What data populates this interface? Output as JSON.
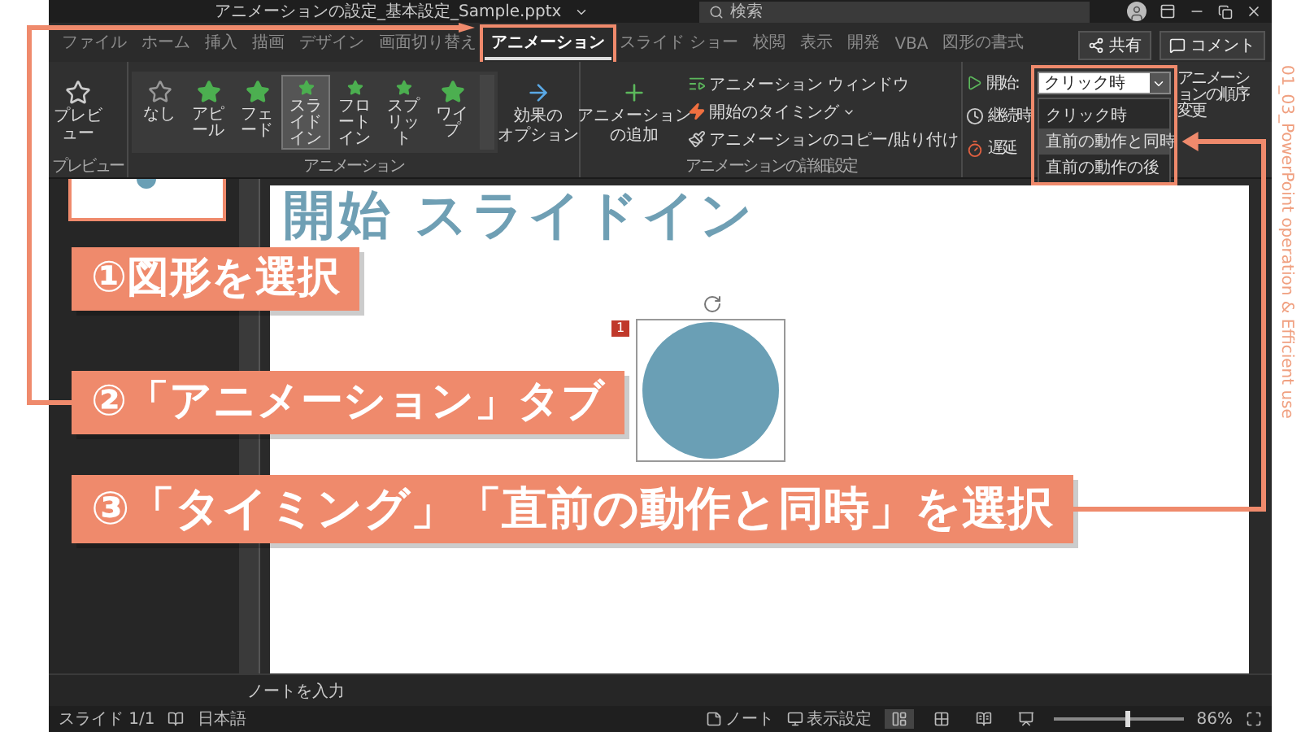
{
  "window": {
    "title": "アニメーションの設定_基本設定_Sample.pptx",
    "search": {
      "placeholder": "検索"
    }
  },
  "menu_tabs": [
    {
      "label": "ファイル",
      "selected": false
    },
    {
      "label": "ホーム",
      "selected": false
    },
    {
      "label": "挿入",
      "selected": false
    },
    {
      "label": "描画",
      "selected": false
    },
    {
      "label": "デザイン",
      "selected": false
    },
    {
      "label": "画面切り替え",
      "selected": false
    },
    {
      "label": "アニメーション",
      "selected": true
    },
    {
      "label": "スライド ショー",
      "selected": false
    },
    {
      "label": "校閲",
      "selected": false
    },
    {
      "label": "表示",
      "selected": false
    },
    {
      "label": "開発",
      "selected": false
    },
    {
      "label": "VBA",
      "selected": false
    },
    {
      "label": "図形の書式",
      "selected": false
    }
  ],
  "header_buttons": [
    {
      "label": "共有",
      "kind": "share"
    },
    {
      "label": "コメント",
      "kind": "comment"
    }
  ],
  "ribbon": {
    "preview": {
      "label": "プレビュー",
      "group": "プレビュー"
    },
    "animation": {
      "group": "アニメーション",
      "effect_options": [
        "効果の",
        "オプション"
      ],
      "gallery": [
        {
          "label": "なし",
          "kind": "none",
          "selected": false
        },
        {
          "label": "アピール",
          "kind": "entrance",
          "selected": false
        },
        {
          "label": "フェード",
          "kind": "entrance",
          "selected": false
        },
        {
          "label": "スライドイン",
          "kind": "entrance",
          "selected": true
        },
        {
          "label": "フロートイン",
          "kind": "entrance",
          "selected": false
        },
        {
          "label": "スプリット",
          "kind": "entrance",
          "selected": false
        },
        {
          "label": "ワイプ",
          "kind": "entrance",
          "selected": false
        }
      ]
    },
    "advanced": {
      "group": "アニメーションの詳細設定",
      "add": [
        "アニメーション",
        "の追加"
      ],
      "items": [
        {
          "label": "アニメーション ウィンドウ",
          "kind": "pane",
          "has_menu": false
        },
        {
          "label": "開始のタイミング",
          "kind": "trigger",
          "has_menu": true
        },
        {
          "label": "アニメーションのコピー/貼り付け",
          "kind": "painter",
          "has_menu": false
        }
      ]
    },
    "timing": {
      "start_label": "開始:",
      "start_value": "クリック時",
      "rows": [
        {
          "label": "継続時",
          "kind": "duration"
        },
        {
          "label": "遅延",
          "kind": "delay"
        }
      ],
      "reorder": "アニメーションの順序変更",
      "options": [
        {
          "label": "クリック時",
          "selected": false
        },
        {
          "label": "直前の動作と同時",
          "selected": true
        },
        {
          "label": "直前の動作の後",
          "selected": false
        }
      ]
    }
  },
  "slide": {
    "title": "開始 スライドイン",
    "animation_tag": "1"
  },
  "notes": {
    "placeholder": "ノートを入力"
  },
  "status_bar": {
    "slide": "スライド 1/1",
    "language": "日本語",
    "notes": "ノート",
    "view_settings": "表示設定",
    "zoom": "86%",
    "zoom_slider": {
      "level": 0.55
    }
  },
  "callouts": [
    {
      "text": "①図形を選択"
    },
    {
      "text": "②「アニメーション」タブ"
    },
    {
      "text": "③「タイミング」「直前の動作と同時」を選択"
    }
  ],
  "side_caption": "01_03_PowerPoint operation & Efficient use"
}
